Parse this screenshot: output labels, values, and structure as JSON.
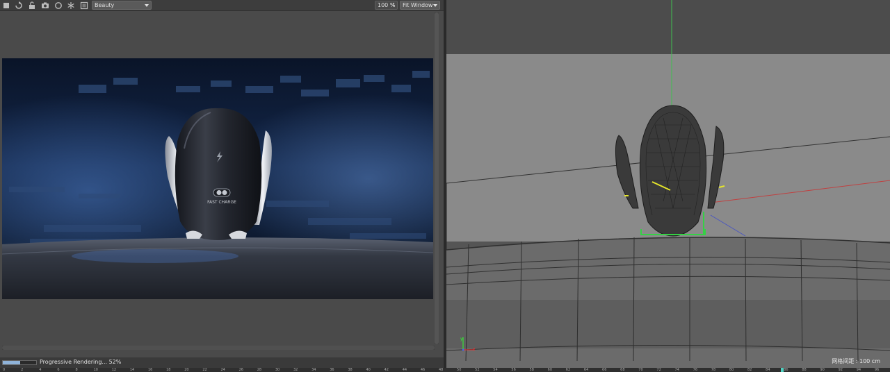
{
  "toolbar": {
    "icons": [
      "stop-icon",
      "refresh-icon",
      "lock-icon",
      "camera-icon",
      "circle-icon",
      "snowflake-icon",
      "region-icon"
    ],
    "channel_select": "Beauty",
    "zoom_value": "100 %",
    "fit_select": "Fit Window"
  },
  "render": {
    "label_on_product": "FAST CHARGE",
    "progress_percent": 52,
    "status_text": "Progressive Rendering... 52%"
  },
  "viewport": {
    "grid_spacing_label": "网格间距 : 100 cm"
  },
  "timeline": {
    "frames": [
      "0",
      "2",
      "4",
      "6",
      "8",
      "10",
      "12",
      "14",
      "16",
      "18",
      "20",
      "22",
      "24",
      "26",
      "28",
      "30",
      "32",
      "34",
      "36",
      "38",
      "40",
      "42",
      "44",
      "46",
      "48",
      "50",
      "52",
      "54",
      "56",
      "58",
      "60",
      "62",
      "64",
      "66",
      "68",
      "70",
      "72",
      "74",
      "76",
      "78",
      "80",
      "82",
      "84",
      "86",
      "88",
      "90",
      "92",
      "94",
      "96"
    ],
    "current_frame": "86"
  },
  "colors": {
    "panel_bg": "#4a4a4a",
    "toolbar_bg": "#3d3d3d",
    "viewport_bg": "#505050",
    "progress_fill": "#8fb3d9",
    "timeline_marker": "#4fd0c0",
    "axis_x": "#ff3030",
    "axis_y": "#30ff30",
    "axis_z": "#4060ff"
  }
}
